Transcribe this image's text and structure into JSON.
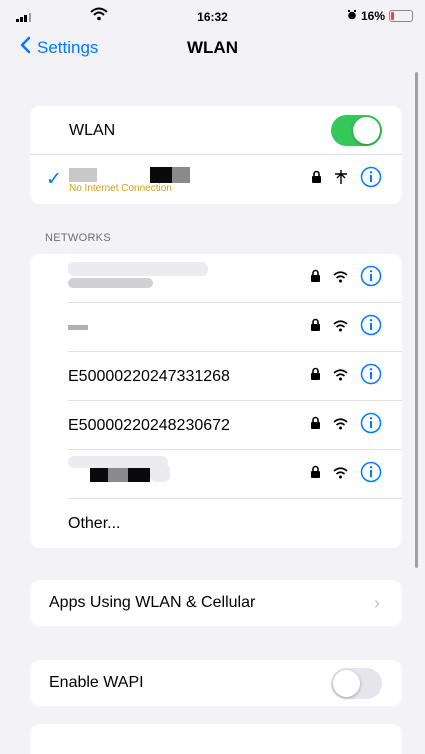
{
  "status_bar": {
    "time": "16:32",
    "battery": "16%",
    "battery_level": 0.16
  },
  "nav": {
    "back_label": "Settings",
    "title": "WLAN"
  },
  "wlan_section": {
    "label": "WLAN",
    "enabled": true,
    "connected_status": "No Internet Connection"
  },
  "networks_section": {
    "header": "NETWORKS",
    "networks": [
      {
        "name": "E50000220247331268"
      },
      {
        "name": "E50000220248230672"
      }
    ],
    "other_label": "Other..."
  },
  "apps_section": {
    "label": "Apps Using WLAN & Cellular"
  },
  "wapi_section": {
    "label": "Enable WAPI",
    "enabled": false
  },
  "colors": {
    "accent": "#007aff",
    "toggle_on": "#34c759",
    "battery_low": "#ff3b30"
  }
}
